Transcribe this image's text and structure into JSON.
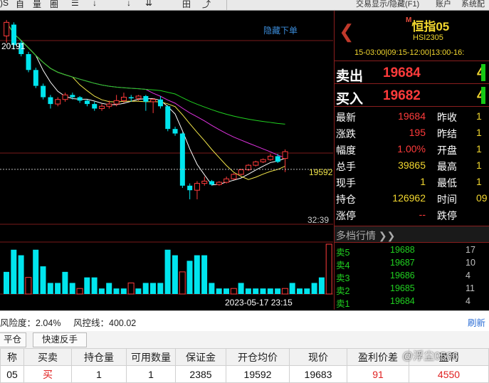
{
  "toolbar": {
    "items": [
      ")S",
      "自",
      "量",
      "圈",
      "☰",
      "↓",
      "↓",
      "⇊",
      "田",
      "⤴"
    ],
    "menu_items": [
      "交易显示/隐藏(F1)",
      "账户",
      "系统配"
    ]
  },
  "chart": {
    "hide_label": "隐藏下单",
    "high_label": "20191",
    "price_label": "19592",
    "countdown": "32:39",
    "timestamp": "2023-05-17 23:15",
    "colors": {
      "up": "#ff3b3b",
      "down": "#00e5ee",
      "ma5": "#ffffff",
      "ma10": "#f2e64a",
      "ma20": "#e033e0",
      "ma60": "#20d020",
      "grid": "#7a1a1a"
    },
    "y_range": [
      19350,
      20260
    ],
    "candles": [
      {
        "o": 20180,
        "c": 20240,
        "h": 20250,
        "l": 20150
      },
      {
        "o": 20230,
        "c": 20140,
        "h": 20240,
        "l": 20120
      },
      {
        "o": 20150,
        "c": 20100,
        "h": 20160,
        "l": 20090
      },
      {
        "o": 20100,
        "c": 20030,
        "h": 20110,
        "l": 20020
      },
      {
        "o": 20030,
        "c": 19960,
        "h": 20040,
        "l": 19950
      },
      {
        "o": 19960,
        "c": 19910,
        "h": 19970,
        "l": 19900
      },
      {
        "o": 19910,
        "c": 19880,
        "h": 19920,
        "l": 19860
      },
      {
        "o": 19880,
        "c": 19900,
        "h": 19910,
        "l": 19870
      },
      {
        "o": 19900,
        "c": 19920,
        "h": 19930,
        "l": 19890
      },
      {
        "o": 19920,
        "c": 19910,
        "h": 19930,
        "l": 19900
      },
      {
        "o": 19910,
        "c": 19895,
        "h": 19915,
        "l": 19885
      },
      {
        "o": 19895,
        "c": 19880,
        "h": 19900,
        "l": 19870
      },
      {
        "o": 19880,
        "c": 19860,
        "h": 19890,
        "l": 19850
      },
      {
        "o": 19860,
        "c": 19870,
        "h": 19880,
        "l": 19850
      },
      {
        "o": 19870,
        "c": 19880,
        "h": 19895,
        "l": 19860
      },
      {
        "o": 19880,
        "c": 19895,
        "h": 19920,
        "l": 19870
      },
      {
        "o": 19895,
        "c": 19910,
        "h": 19930,
        "l": 19885
      },
      {
        "o": 19910,
        "c": 19905,
        "h": 19920,
        "l": 19890
      },
      {
        "o": 19905,
        "c": 19915,
        "h": 19920,
        "l": 19895
      },
      {
        "o": 19915,
        "c": 19890,
        "h": 19920,
        "l": 19850
      },
      {
        "o": 19890,
        "c": 19900,
        "h": 19905,
        "l": 19840
      },
      {
        "o": 19900,
        "c": 19870,
        "h": 19915,
        "l": 19860
      },
      {
        "o": 19870,
        "c": 19770,
        "h": 19875,
        "l": 19760
      },
      {
        "o": 19770,
        "c": 19750,
        "h": 19780,
        "l": 19740
      },
      {
        "o": 19750,
        "c": 19520,
        "h": 19755,
        "l": 19510
      },
      {
        "o": 19520,
        "c": 19500,
        "h": 19530,
        "l": 19460
      },
      {
        "o": 19500,
        "c": 19530,
        "h": 19540,
        "l": 19460
      },
      {
        "o": 19530,
        "c": 19540,
        "h": 19560,
        "l": 19520
      },
      {
        "o": 19540,
        "c": 19525,
        "h": 19545,
        "l": 19520
      },
      {
        "o": 19525,
        "c": 19535,
        "h": 19540,
        "l": 19520
      },
      {
        "o": 19535,
        "c": 19550,
        "h": 19560,
        "l": 19530
      },
      {
        "o": 19550,
        "c": 19570,
        "h": 19575,
        "l": 19545
      },
      {
        "o": 19570,
        "c": 19590,
        "h": 19595,
        "l": 19565
      },
      {
        "o": 19590,
        "c": 19610,
        "h": 19615,
        "l": 19585
      },
      {
        "o": 19610,
        "c": 19625,
        "h": 19630,
        "l": 19605
      },
      {
        "o": 19625,
        "c": 19635,
        "h": 19640,
        "l": 19620
      },
      {
        "o": 19635,
        "c": 19650,
        "h": 19660,
        "l": 19630
      },
      {
        "o": 19650,
        "c": 19625,
        "h": 19660,
        "l": 19620
      },
      {
        "o": 19640,
        "c": 19670,
        "h": 19680,
        "l": 19580
      }
    ],
    "volumes": [
      40,
      80,
      70,
      30,
      80,
      50,
      20,
      20,
      40,
      20,
      10,
      30,
      30,
      10,
      20,
      10,
      10,
      20,
      10,
      20,
      20,
      20,
      80,
      70,
      40,
      60,
      70,
      70,
      20,
      10,
      10,
      10,
      20,
      10,
      10,
      10,
      10,
      10,
      10,
      20,
      10,
      10,
      20,
      30,
      90
    ]
  },
  "quote": {
    "logo_letter": "M",
    "title": "恒指05",
    "code": "HSI2305",
    "session": "15-03:00|09:15-12:00|13:00-16:",
    "ask_label": "卖出",
    "ask_price": "19684",
    "ask_vol": "4",
    "bid_label": "买入",
    "bid_price": "19682",
    "bid_vol": "4",
    "stats": [
      {
        "label": "最新",
        "value": "19684",
        "label2": "昨收",
        "value2": "1",
        "color": "#ff3b3b"
      },
      {
        "label": "涨跌",
        "value": "195",
        "label2": "昨结",
        "value2": "1",
        "color": "#ff3b3b"
      },
      {
        "label": "幅度",
        "value": "1.00%",
        "label2": "开盘",
        "value2": "1",
        "color": "#ff3b3b"
      },
      {
        "label": "总手",
        "value": "39865",
        "label2": "最高",
        "value2": "1",
        "color": "#f2d72f"
      },
      {
        "label": "现手",
        "value": "1",
        "label2": "最低",
        "value2": "1",
        "color": "#f2d72f"
      },
      {
        "label": "持仓",
        "value": "126962",
        "label2": "时间",
        "value2": "09",
        "color": "#f2d72f"
      },
      {
        "label": "涨停",
        "value": "--",
        "label2": "跌停",
        "value2": "",
        "color": "#ff3b3b"
      }
    ],
    "depth_title": "多档行情 ❯❯",
    "depth": [
      {
        "label": "卖5",
        "price": "19688",
        "vol": "17"
      },
      {
        "label": "卖4",
        "price": "19687",
        "vol": "10"
      },
      {
        "label": "卖3",
        "price": "19686",
        "vol": "4"
      },
      {
        "label": "卖2",
        "price": "19685",
        "vol": "11"
      },
      {
        "label": "卖1",
        "price": "19684",
        "vol": "4"
      }
    ]
  },
  "status": {
    "risk": "风险度：2.04%",
    "control": "风控线：400.02",
    "refresh": "刷新"
  },
  "buttons": {
    "close": "平仓",
    "reverse": "快速反手"
  },
  "table": {
    "headers": [
      "称",
      "买卖",
      "持仓量",
      "可用数量",
      "保证金",
      "开仓均价",
      "现价",
      "盈利价差",
      "盈利"
    ],
    "row": [
      "05",
      "买",
      "1",
      "1",
      "2385",
      "19592",
      "19683",
      "91",
      "4550"
    ]
  },
  "watermark": "@浮尘0506"
}
